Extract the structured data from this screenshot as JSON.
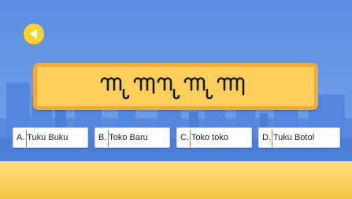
{
  "question": {
    "script_text": "ꦠꦸꦏꦸꦧꦸꦏꦸ",
    "script_name": "javanese-script-word"
  },
  "answers": [
    {
      "label": "A. Tuku Buku"
    },
    {
      "label": "B. Toko Baru"
    },
    {
      "label": "C. Toko toko"
    },
    {
      "label": "D. Tuku Botol"
    }
  ],
  "icons": {
    "back": "back-arrow-icon"
  },
  "colors": {
    "sky": "#6a9ae6",
    "skyline": "#4f82d8",
    "card_fill": "#ffcf5c",
    "card_border": "#f2a93b",
    "ground": "#f6c445",
    "back_button": "#ffd232"
  }
}
